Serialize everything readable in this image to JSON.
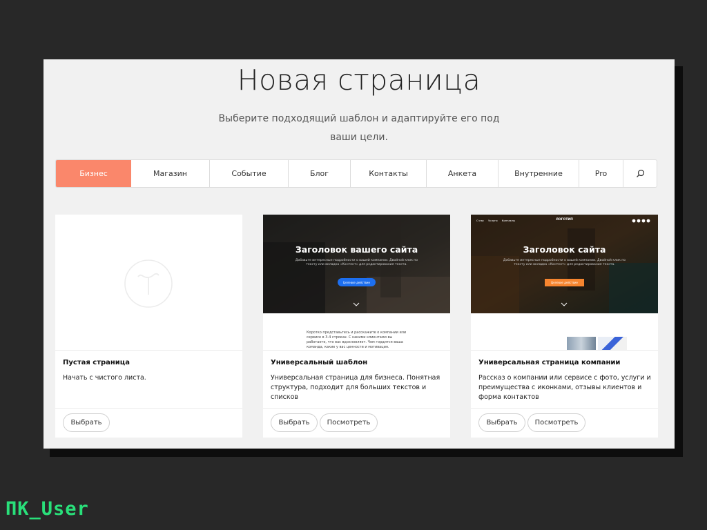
{
  "page": {
    "title": "Новая страница",
    "subtitle": "Выберите подходящий шаблон и адаптируйте его под ваши цели."
  },
  "tabs": [
    {
      "label": "Бизнес",
      "active": true
    },
    {
      "label": "Магазин"
    },
    {
      "label": "Событие"
    },
    {
      "label": "Блог"
    },
    {
      "label": "Контакты"
    },
    {
      "label": "Анкета"
    },
    {
      "label": "Внутренние"
    },
    {
      "label": "Pro"
    }
  ],
  "search_icon": "search-icon",
  "cards": [
    {
      "name": "Пустая страница",
      "description": "Начать с чистого листа.",
      "select_label": "Выбрать",
      "icon": "tilda-logo-icon"
    },
    {
      "name": "Универсальный шаблон",
      "description": "Универсальная страница для бизнеса. Понятная структура, подходит для больших текстов и списков",
      "select_label": "Выбрать",
      "view_label": "Посмотреть",
      "preview": {
        "hero_title": "Заголовок вашего сайта",
        "hero_sub": "Добавьте интересные подробности о вашей компании. Двойной клик по тексту или вкладка «Контент» для редактирования текста.",
        "hero_button": "Целевое действие",
        "body_text": "Коротко представьтесь и расскажите о компании или сервисе в 3-4 строках. С какими клиентами вы работаете, что вас вдохновляет. Чем гордится ваша команда, какие у вас ценности и мотивация."
      }
    },
    {
      "name": "Универсальная страница компании",
      "description": "Рассказ о компании или сервисе с фото, услуги и преимущества с иконками, отзывы клиентов и форма контактов",
      "select_label": "Выбрать",
      "view_label": "Посмотреть",
      "preview": {
        "logo": "ЛОГОТИП",
        "nav": [
          "О нас",
          "Услуги",
          "Контакты"
        ],
        "hero_title": "Заголовок сайта",
        "hero_sub": "Добавьте интересные подробности о вашей компании. Двойной клик по тексту или вкладка «Контент» для редактирования текста.",
        "hero_button": "Целевое действие"
      }
    }
  ],
  "watermark": "ПК_User",
  "colors": {
    "accent": "#fa876b",
    "watermark": "#29e07a",
    "blue_button": "#1d6ff0",
    "orange_button": "#f7852f"
  }
}
